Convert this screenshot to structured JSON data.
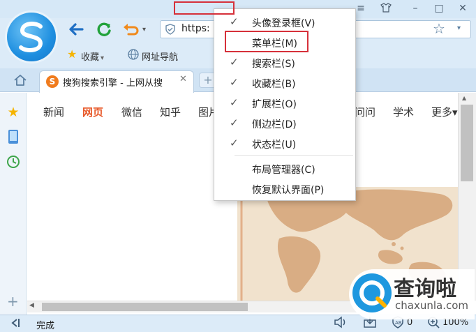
{
  "titlebar": {
    "window_buttons": [
      "≡",
      "👕",
      "–",
      "□",
      "✕"
    ]
  },
  "toolbar": {
    "back_icon": "back-arrow-icon",
    "refresh_icon": "refresh-icon",
    "undo_icon": "undo-icon",
    "address": {
      "url_visible": "https:",
      "shield_icon": "shield-icon"
    },
    "bookmark_star_icon": "star-icon"
  },
  "favorites_bar": {
    "favorites_label": "收藏",
    "favorites_arrow": "▾",
    "nav_label": "网址导航"
  },
  "tabs": {
    "home_icon": "home-icon",
    "active": {
      "favicon": "S",
      "title": "搜狗搜索引擎 - 上网从搜",
      "close": "✕"
    },
    "new_tab": "+"
  },
  "sidebar": {
    "icons": [
      "star-icon",
      "tablet-icon",
      "clock-icon"
    ],
    "add": "+"
  },
  "page": {
    "nav_tabs": [
      "新闻",
      "网页",
      "微信",
      "知乎",
      "图片",
      "问问",
      "学术",
      "更多▾"
    ]
  },
  "context_menu": {
    "items": [
      {
        "checked": true,
        "label": "头像登录框(V)"
      },
      {
        "checked": false,
        "label": "菜单栏(M)"
      },
      {
        "checked": true,
        "label": "搜索栏(S)"
      },
      {
        "checked": true,
        "label": "收藏栏(B)"
      },
      {
        "checked": true,
        "label": "扩展栏(O)"
      },
      {
        "checked": true,
        "label": "侧边栏(D)"
      },
      {
        "checked": true,
        "label": "状态栏(U)"
      }
    ],
    "extra_items": [
      {
        "label": "布局管理器(C)"
      },
      {
        "label": "恢复默认界面(P)"
      }
    ],
    "check_glyph": "✓"
  },
  "statusbar": {
    "left_icon": "panel-toggle-icon",
    "status": "完成",
    "adblock_count": "0",
    "zoom": "100%"
  },
  "watermark": {
    "brand": "查询啦",
    "url": "chaxunla.com"
  },
  "colors": {
    "accent": "#1f8fe0",
    "highlight": "#d6303a",
    "nav_active": "#e85b2c"
  }
}
